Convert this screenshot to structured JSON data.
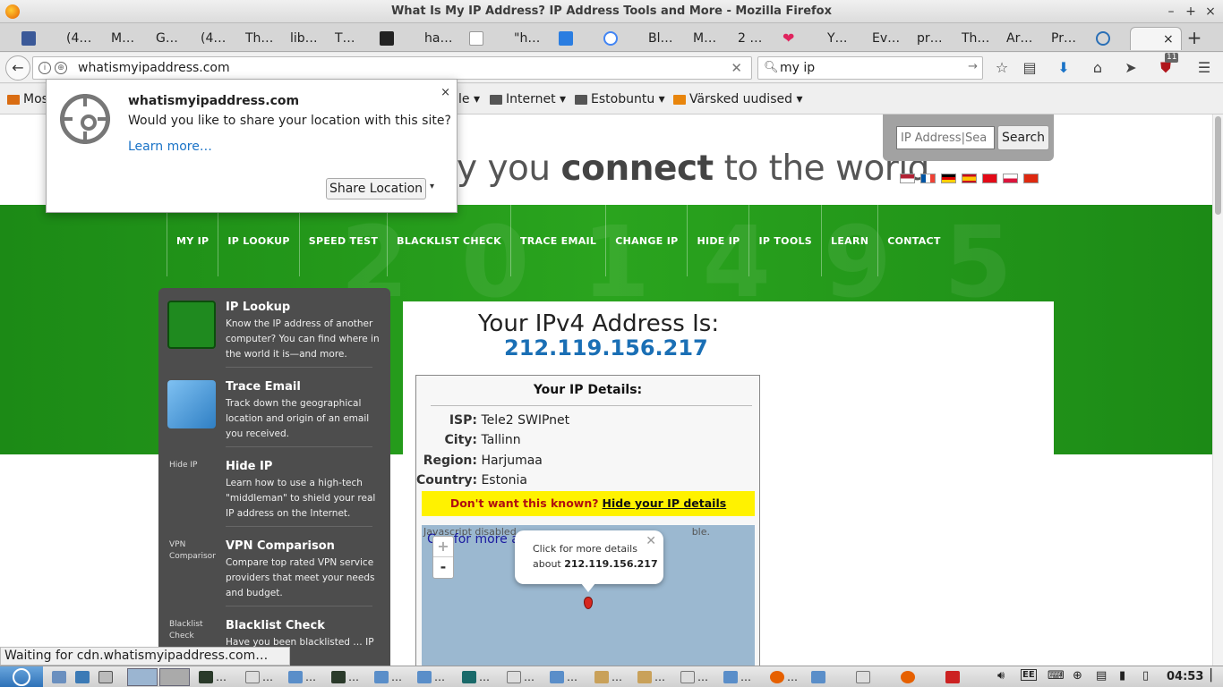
{
  "window": {
    "title": "What Is My IP Address? IP Address Tools and More - Mozilla Firefox"
  },
  "tabs": [
    {
      "label": ""
    },
    {
      "label": "(4…"
    },
    {
      "label": "M…"
    },
    {
      "label": "G…"
    },
    {
      "label": "(4…"
    },
    {
      "label": "Th…"
    },
    {
      "label": "lib…"
    },
    {
      "label": "T…"
    },
    {
      "label": ""
    },
    {
      "label": "ha…"
    },
    {
      "label": ""
    },
    {
      "label": "\"h…"
    },
    {
      "label": ""
    },
    {
      "label": ""
    },
    {
      "label": "Bl…"
    },
    {
      "label": "M…"
    },
    {
      "label": "2 …"
    },
    {
      "label": ""
    },
    {
      "label": "Y…"
    },
    {
      "label": "Ev…"
    },
    {
      "label": "pr…"
    },
    {
      "label": "Th…"
    },
    {
      "label": "Ar…"
    },
    {
      "label": "Pr…"
    },
    {
      "label": ""
    }
  ],
  "nav": {
    "url": "whatismyipaddress.com",
    "search_value": "my ip",
    "badge_count": "11"
  },
  "bookmarks": [
    {
      "label": "Mos"
    },
    {
      "label": "le ▾"
    },
    {
      "label": "Internet ▾"
    },
    {
      "label": "Estobuntu ▾"
    },
    {
      "label": "Värsked uudised ▾"
    }
  ],
  "site": {
    "tagline_prefix": "y you ",
    "tagline_bold": "connect",
    "tagline_suffix": " to the world",
    "search_placeholder": "IP Address|Sea",
    "search_button": "Search",
    "menu": [
      "MY IP",
      "IP LOOKUP",
      "SPEED TEST",
      "BLACKLIST CHECK",
      "TRACE EMAIL",
      "CHANGE IP",
      "HIDE IP",
      "IP TOOLS",
      "LEARN",
      "CONTACT"
    ]
  },
  "sidebar": [
    {
      "title": "IP Lookup",
      "desc": "Know the IP address of another computer? You can find where in the world it is—and more.",
      "alt": ""
    },
    {
      "title": "Trace Email",
      "desc": "Track down the geographical location and origin of an email you received.",
      "alt": ""
    },
    {
      "title": "Hide IP",
      "desc": "Learn how to use a high-tech \"middleman\" to shield your real IP address on the Internet.",
      "alt": "Hide IP"
    },
    {
      "title": "VPN Comparison",
      "desc": "Compare top rated VPN service providers that meet your needs and budget.",
      "alt": "VPN Comparison"
    },
    {
      "title": "Blacklist Check",
      "desc": "Have you been blacklisted … IP address you",
      "alt": "Blacklist Check"
    }
  ],
  "main": {
    "ipv4_title": "Your IPv4 Address Is:",
    "ipv4_value": "212.119.156.217",
    "details_title": "Your IP Details:",
    "details": [
      {
        "key": "ISP:",
        "value": "Tele2 SWIPnet"
      },
      {
        "key": "City:",
        "value": "Tallinn"
      },
      {
        "key": "Region:",
        "value": "Harjumaa"
      },
      {
        "key": "Country:",
        "value": "Estonia"
      }
    ],
    "hide_prompt": "Don't want this known?",
    "hide_link": "Hide your IP details",
    "map_js_note": "Javascript disabled",
    "map_js_note_tail": "ble.",
    "map_link": "for more about 212.119.156.217",
    "map_link_prefix": "C",
    "popup_line1": "Click for more details",
    "popup_line2_prefix": "about ",
    "popup_line2_ip": "212.119.156.217",
    "zoom_in": "+",
    "zoom_out": "-"
  },
  "location_prompt": {
    "host": "whatismyipaddress.com",
    "question": "Would you like to share your location with this site?",
    "learn_more": "Learn more…",
    "share_button": "Share Location",
    "close": "×"
  },
  "status": "Waiting for cdn.whatismyipaddress.com…",
  "taskbar": {
    "clock": "04:53",
    "items": [
      "…",
      "…",
      "…",
      "…",
      "…",
      "…",
      "…",
      "…",
      "…",
      "…",
      "…",
      "…",
      "…",
      "…"
    ]
  }
}
